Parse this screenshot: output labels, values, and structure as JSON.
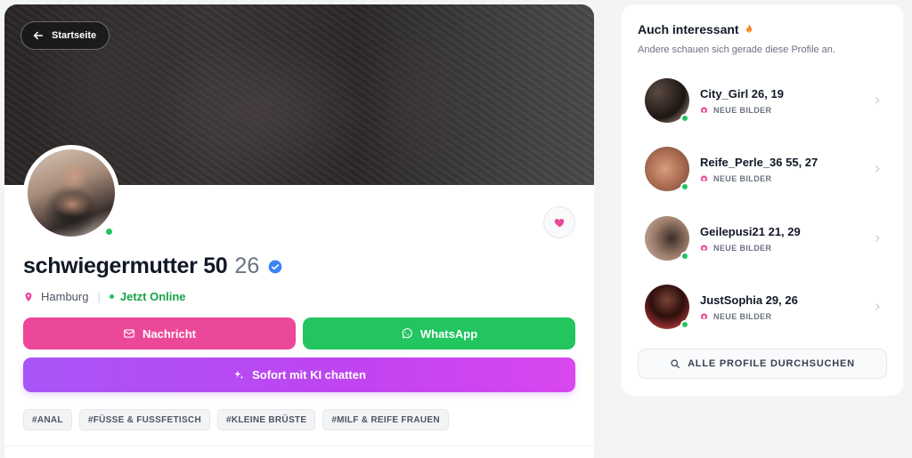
{
  "nav": {
    "back_label": "Startseite"
  },
  "profile": {
    "name": "schwiegermutter 50",
    "age": "26",
    "location": "Hamburg",
    "status": "Jetzt Online",
    "verified": true
  },
  "actions": {
    "message_label": "Nachricht",
    "whatsapp_label": "WhatsApp",
    "ai_chat_label": "Sofort mit KI chatten"
  },
  "tags": [
    "#ANAL",
    "#FÜSSE & FUSSFETISCH",
    "#KLEINE BRÜSTE",
    "#MILF & REIFE FRAUEN"
  ],
  "sidebar": {
    "title": "Auch interessant",
    "subtitle": "Andere schauen sich gerade diese Profile an.",
    "suggestions": [
      {
        "name": "City_Girl 26, 19",
        "badge": "NEUE BILDER"
      },
      {
        "name": "Reife_Perle_36 55, 27",
        "badge": "NEUE BILDER"
      },
      {
        "name": "Geilepusi21 21, 29",
        "badge": "NEUE BILDER"
      },
      {
        "name": "JustSophia 29, 26",
        "badge": "NEUE BILDER"
      }
    ],
    "browse_all_label": "ALLE PROFILE DURCHSUCHEN"
  },
  "colors": {
    "pink": "#ec4899",
    "green": "#22c55e",
    "purple_start": "#a855f7",
    "purple_end": "#d946ef",
    "verified_blue": "#3b82f6"
  },
  "icons": [
    "arrow-left-icon",
    "heart-icon",
    "verified-icon",
    "map-pin-icon",
    "mail-icon",
    "whatsapp-icon",
    "sparkle-icon",
    "flame-icon",
    "camera-icon",
    "chevron-right-icon",
    "search-icon"
  ]
}
